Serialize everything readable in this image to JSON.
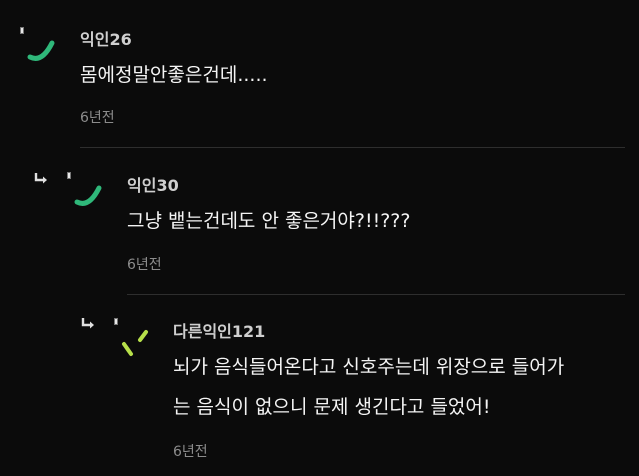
{
  "colors": {
    "background": "#0b0b0b",
    "accent_green": "#2fb87a",
    "accent_lime": "#b7e04a",
    "nick": "#cfcfcf",
    "body_text": "#f4f4f4",
    "timestamp": "#8c8c8c"
  },
  "comments": [
    {
      "nickname": "익인26",
      "text": "몸에정말안좋은건데.....",
      "time": "6년전",
      "avatar_icon": "green-arc-icon"
    },
    {
      "nickname": "익인30",
      "text": "그냥 뱉는건데도 안 좋은거야?!!???",
      "time": "6년전",
      "avatar_icon": "green-arc-icon",
      "reply_icon": "reply-arrow-icon"
    },
    {
      "nickname": "다른익인121",
      "text_lines": [
        "뇌가 음식들어온다고 신호주는데 위장으로 들어가",
        "는 음식이 없으니 문제 생긴다고 들었어!"
      ],
      "time": "6년전",
      "avatar_icon": "lime-strokes-icon",
      "reply_icon": "reply-arrow-icon"
    }
  ]
}
